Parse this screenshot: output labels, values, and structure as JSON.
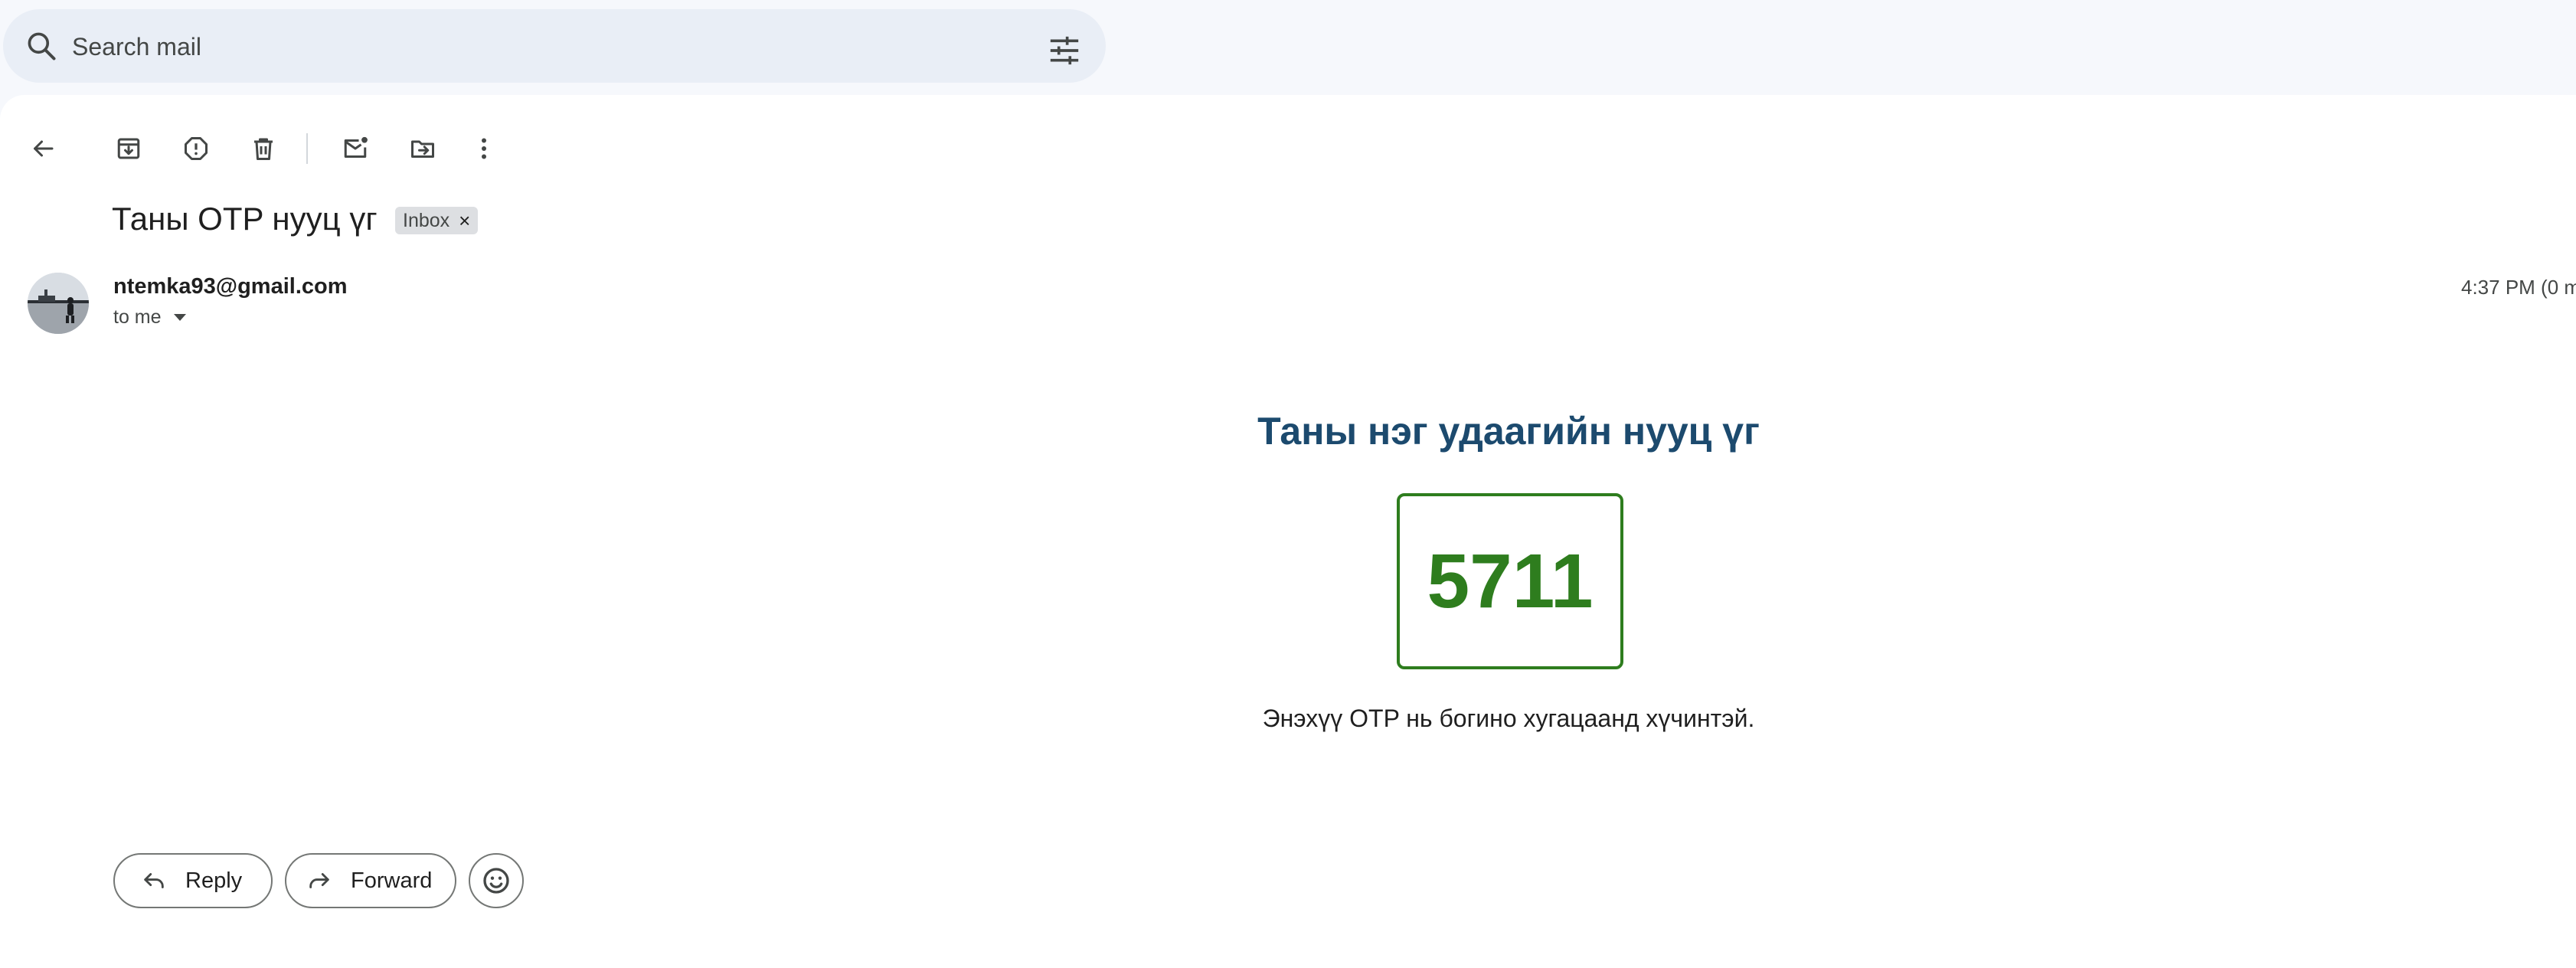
{
  "search": {
    "placeholder": "Search mail"
  },
  "email": {
    "subject": "Таны OTP нууц үг",
    "label": "Inbox",
    "label_remove": "×",
    "sender": "ntemka93@gmail.com",
    "recipient": "to me",
    "time": "4:37 PM (0 min",
    "body": {
      "heading": "Таны нэг удаагийн нууц үг",
      "otp_code": "5711",
      "note": "Энэхүү OTP нь богино хугацаанд хүчинтэй."
    }
  },
  "actions": {
    "reply": "Reply",
    "forward": "Forward"
  },
  "colors": {
    "heading": "#1c4a6e",
    "otp": "#2e7d1e",
    "panel": "#ffffff",
    "background": "#f6f8fc"
  },
  "icons": {
    "toolbar": [
      "back-arrow-icon",
      "archive-icon",
      "report-spam-icon",
      "delete-icon",
      "mark-unread-icon",
      "move-to-icon",
      "more-options-icon"
    ]
  }
}
